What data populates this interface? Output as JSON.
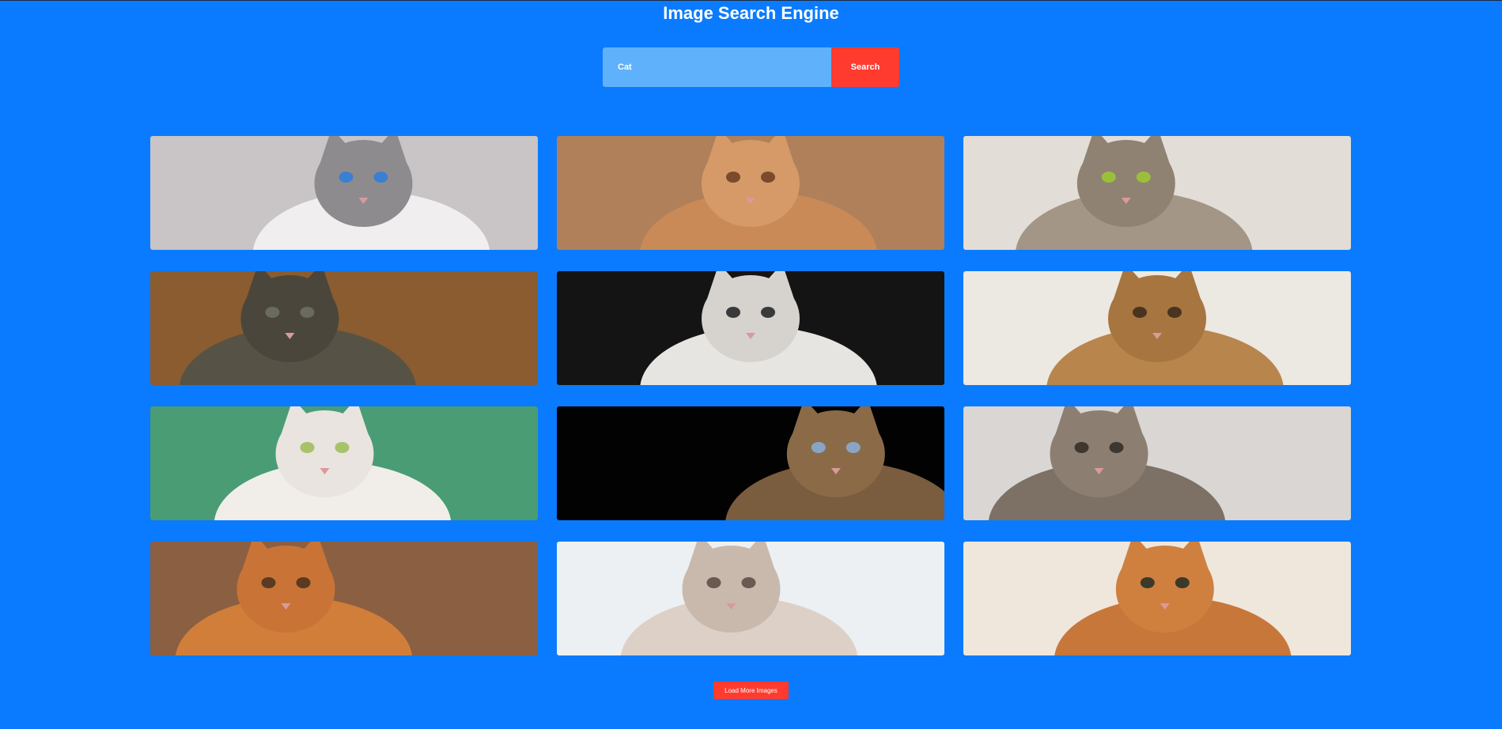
{
  "app": {
    "title": "Image Search Engine"
  },
  "search": {
    "value": "Cat",
    "button_label": "Search"
  },
  "results": [
    {
      "name": "result-image-siamese-cat",
      "bg": "#c9c4c6",
      "body": "#f0eeee",
      "head": "#8e8b8f",
      "eye": "#3b7fd1"
    },
    {
      "name": "result-image-ginger-cat-sleeping",
      "bg": "#b0805a",
      "body": "#c98a58",
      "head": "#d59a67",
      "eye": "#7a4a2b"
    },
    {
      "name": "result-image-fluffy-tabby",
      "bg": "#e3ddd7",
      "body": "#a39686",
      "head": "#8f8272",
      "eye": "#9bbf3a"
    },
    {
      "name": "result-image-grey-cat-on-wood",
      "bg": "#8a5c2f",
      "body": "#575246",
      "head": "#4a463c",
      "eye": "#6b6a5e"
    },
    {
      "name": "result-image-kitten-with-leaves",
      "bg": "#141414",
      "body": "#e7e5e2",
      "head": "#d6d3cf",
      "eye": "#3a3a3a"
    },
    {
      "name": "result-image-bengal-cat-kitchen",
      "bg": "#ece8e2",
      "body": "#b8854d",
      "head": "#a7753f",
      "eye": "#4a3320"
    },
    {
      "name": "result-image-black-white-cat",
      "bg": "#4a9c74",
      "body": "#f1eeea",
      "head": "#e9e4df",
      "eye": "#a8c26a"
    },
    {
      "name": "result-image-tabby-closeup-dark",
      "bg": "#020202",
      "body": "#7a5c3e",
      "head": "#8b6a48",
      "eye": "#8aa5c4"
    },
    {
      "name": "result-image-tabby-with-hand",
      "bg": "#d9d6d3",
      "body": "#7d7064",
      "head": "#8c7f72",
      "eye": "#3d3730"
    },
    {
      "name": "result-image-orange-longhair",
      "bg": "#8b5f42",
      "body": "#d07e3a",
      "head": "#c97436",
      "eye": "#5a3a22"
    },
    {
      "name": "result-image-kitten-in-blanket",
      "bg": "#edf0f2",
      "body": "#ddd0c6",
      "head": "#c9b9ad",
      "eye": "#6a5a52"
    },
    {
      "name": "result-image-orange-cat-stretching",
      "bg": "#efe7dc",
      "body": "#c8773a",
      "head": "#cf803f",
      "eye": "#3b3a2a"
    }
  ],
  "load_more": {
    "label": "Load More Images"
  }
}
